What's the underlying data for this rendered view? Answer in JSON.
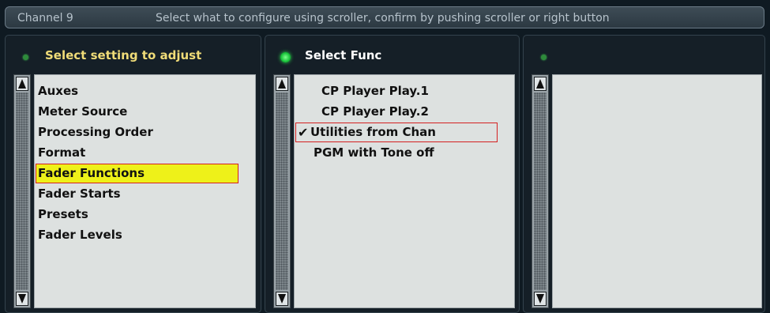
{
  "topbar": {
    "channel": "Channel 9",
    "message": "Select what to configure using scroller, confirm by pushing scroller or right button"
  },
  "panels": [
    {
      "title": "Select setting to adjust",
      "led": "small",
      "items": [
        "Auxes",
        "Meter Source",
        "Processing Order",
        "Format",
        "Fader Functions",
        "Fader Starts",
        "Presets",
        "Fader Levels"
      ],
      "selected_index": 4
    },
    {
      "title": "Select Func",
      "led": "big",
      "items": [
        "CP Player Play.1",
        "CP Player Play.2",
        "Utilities from Chan",
        "PGM with Tone off"
      ],
      "checked_index": 2,
      "check_mark": "✔"
    },
    {
      "title": "",
      "led": "small",
      "items": []
    }
  ],
  "colors": {
    "accent_title": "#f0dc78",
    "selection": "#eef119",
    "selection_border": "#d42121",
    "led_on": "#18c23a"
  },
  "icons": {
    "scroll_up": "triangle-up-icon",
    "scroll_down": "triangle-down-icon",
    "check": "checkmark-icon"
  }
}
